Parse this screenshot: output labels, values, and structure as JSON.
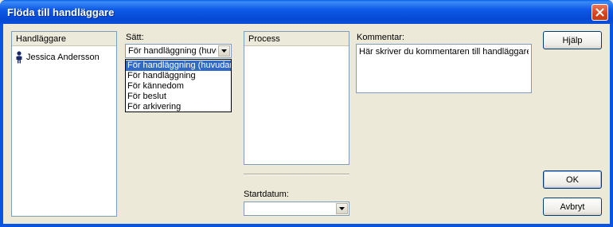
{
  "window": {
    "title": "Flöda till handläggare"
  },
  "handlaggare": {
    "header": "Handläggare",
    "items": [
      {
        "name": "Jessica Andersson",
        "icon": "person-icon"
      }
    ]
  },
  "satt": {
    "label": "Sätt:",
    "selected": "För handläggning (huvu",
    "options": [
      "För handläggning (huvudan",
      "För handläggning",
      "För kännedom",
      "För beslut",
      "För arkivering"
    ]
  },
  "process": {
    "header": "Process"
  },
  "startdatum": {
    "label": "Startdatum:",
    "value": ""
  },
  "kommentar": {
    "label": "Kommentar:",
    "value": "Här skriver du kommentaren till handläggaren"
  },
  "buttons": {
    "help": "Hjälp",
    "ok": "OK",
    "cancel": "Avbryt"
  },
  "colors": {
    "title_bar": "#0a54e3",
    "selection": "#316ac5",
    "close": "#d8421c"
  }
}
